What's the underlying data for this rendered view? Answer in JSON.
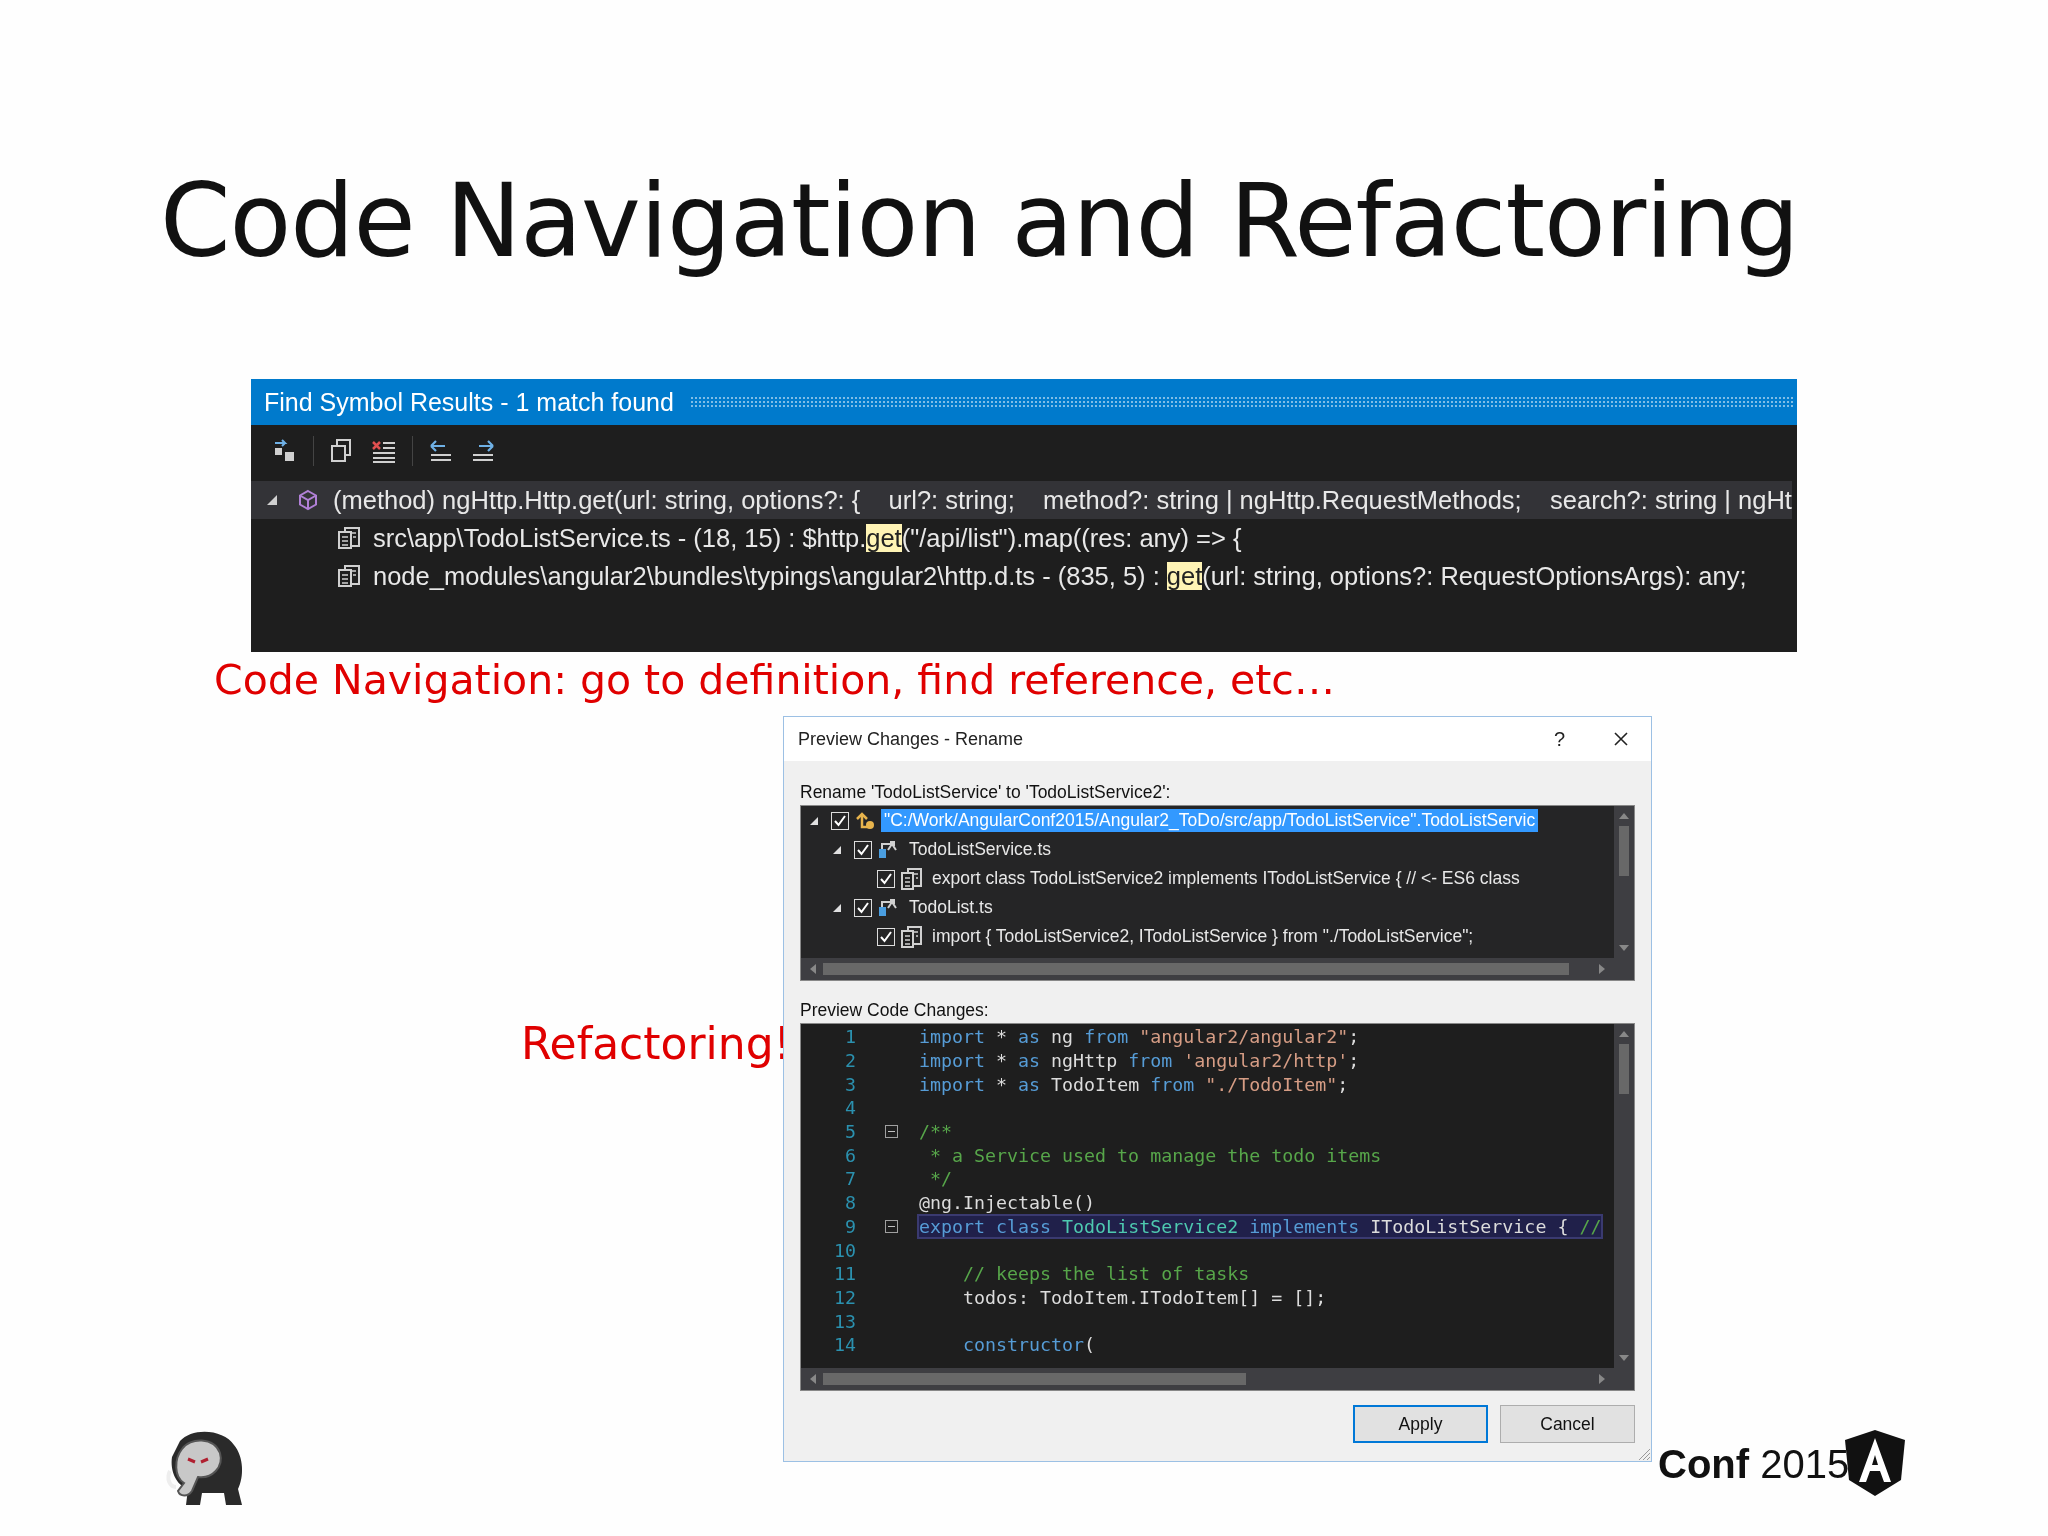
{
  "slide": {
    "title": "Code Navigation and Refactoring"
  },
  "find_results": {
    "title": "Find Symbol Results - 1 match found",
    "rows": [
      {
        "kind": "symbol",
        "expanded": true,
        "selected": true,
        "parts": [
          {
            "text": "(method) ngHttp.Http.get(url: string, options?: {    url?: string;    method?: string | ngHttp.RequestMethods;    search?: string | ngHt",
            "highlighted": false
          }
        ]
      },
      {
        "kind": "reference",
        "selected": false,
        "parts": [
          {
            "text": "src\\app\\TodoListService.ts - (18, 15) : $http.",
            "highlighted": false
          },
          {
            "text": "get",
            "highlighted": true
          },
          {
            "text": "(\"/api/list\").map((res: any) => {",
            "highlighted": false
          }
        ]
      },
      {
        "kind": "reference",
        "selected": false,
        "parts": [
          {
            "text": "node_modules\\angular2\\bundles\\typings\\angular2\\http.d.ts - (835, 5) : ",
            "highlighted": false
          },
          {
            "text": "get",
            "highlighted": true
          },
          {
            "text": "(url: string, options?: RequestOptionsArgs): any;",
            "highlighted": false
          }
        ]
      }
    ]
  },
  "caption_navigation": "Code Navigation: go to definition, find reference, etc…",
  "caption_refactoring": "Refactoring!",
  "dialog": {
    "title": "Preview Changes - Rename",
    "help": "?",
    "rename_label": "Rename 'TodoListService' to 'TodoListService2':",
    "tree": [
      {
        "kind": "project",
        "label": "\"C:/Work/AngularConf2015/Angular2_ToDo/src/app/TodoListService\".TodoListServic",
        "checked": true,
        "expanded": true,
        "selected": true,
        "children": [
          {
            "kind": "file",
            "label": "TodoListService.ts",
            "checked": true,
            "expanded": true,
            "selected": false,
            "children": [
              {
                "kind": "line",
                "label": "export class TodoListService2 implements ITodoListService { // <- ES6 class",
                "checked": true,
                "selected": false
              }
            ]
          },
          {
            "kind": "file",
            "label": "TodoList.ts",
            "checked": true,
            "expanded": true,
            "selected": false,
            "children": [
              {
                "kind": "line",
                "label": "import { TodoListService2, ITodoListService } from \"./TodoListService\";",
                "checked": true,
                "selected": false
              }
            ]
          }
        ]
      }
    ],
    "preview_label": "Preview Code Changes:",
    "code_lines": [
      {
        "number": "1",
        "selected": false,
        "collapsible": false,
        "tokens": [
          {
            "kind": "keyword",
            "text": "import"
          },
          {
            "kind": "plain",
            "text": " * "
          },
          {
            "kind": "keyword",
            "text": "as"
          },
          {
            "kind": "plain",
            "text": " ng "
          },
          {
            "kind": "keyword",
            "text": "from"
          },
          {
            "kind": "string",
            "text": " \"angular2/angular2\""
          },
          {
            "kind": "plain",
            "text": ";"
          }
        ]
      },
      {
        "number": "2",
        "selected": false,
        "collapsible": false,
        "tokens": [
          {
            "kind": "keyword",
            "text": "import"
          },
          {
            "kind": "plain",
            "text": " * "
          },
          {
            "kind": "keyword",
            "text": "as"
          },
          {
            "kind": "plain",
            "text": " ngHttp "
          },
          {
            "kind": "keyword",
            "text": "from"
          },
          {
            "kind": "string",
            "text": " 'angular2/http'"
          },
          {
            "kind": "plain",
            "text": ";"
          }
        ]
      },
      {
        "number": "3",
        "selected": false,
        "collapsible": false,
        "tokens": [
          {
            "kind": "keyword",
            "text": "import"
          },
          {
            "kind": "plain",
            "text": " * "
          },
          {
            "kind": "keyword",
            "text": "as"
          },
          {
            "kind": "plain",
            "text": " TodoItem "
          },
          {
            "kind": "keyword",
            "text": "from"
          },
          {
            "kind": "string",
            "text": " \"./TodoItem\""
          },
          {
            "kind": "plain",
            "text": ";"
          }
        ]
      },
      {
        "number": "4",
        "selected": false,
        "collapsible": false
      },
      {
        "number": "5",
        "selected": false,
        "collapsible": true,
        "tokens": [
          {
            "kind": "comment",
            "text": "/**"
          }
        ]
      },
      {
        "number": "6",
        "selected": false,
        "collapsible": false,
        "tokens": [
          {
            "kind": "comment",
            "text": " * a Service used to manage the todo items"
          }
        ]
      },
      {
        "number": "7",
        "selected": false,
        "collapsible": false,
        "tokens": [
          {
            "kind": "comment",
            "text": " */"
          }
        ]
      },
      {
        "number": "8",
        "selected": false,
        "collapsible": false,
        "tokens": [
          {
            "kind": "plain",
            "text": "@ng.Injectable()"
          }
        ]
      },
      {
        "number": "9",
        "selected": true,
        "collapsible": true,
        "tokens": [
          {
            "kind": "keyword",
            "text": "export"
          },
          {
            "kind": "keyword",
            "text": " class"
          },
          {
            "kind": "type",
            "text": " TodoListService2"
          },
          {
            "kind": "keyword",
            "text": " implements"
          },
          {
            "kind": "plain",
            "text": " ITodoListService { "
          },
          {
            "kind": "comment",
            "text": "//"
          }
        ]
      },
      {
        "number": "10",
        "selected": false,
        "collapsible": false
      },
      {
        "number": "11",
        "selected": false,
        "collapsible": false,
        "tokens": [
          {
            "kind": "comment",
            "text": "    // keeps the list of tasks"
          }
        ]
      },
      {
        "number": "12",
        "selected": false,
        "collapsible": false,
        "tokens": [
          {
            "kind": "plain",
            "text": "    todos: TodoItem.ITodoItem[] = [];"
          }
        ]
      },
      {
        "number": "13",
        "selected": false,
        "collapsible": false
      },
      {
        "number": "14",
        "selected": false,
        "collapsible": false,
        "tokens": [
          {
            "kind": "keyword",
            "text": "    constructor"
          },
          {
            "kind": "plain",
            "text": "("
          }
        ]
      }
    ],
    "buttons": [
      {
        "label": "Apply",
        "default": true
      },
      {
        "label": "Cancel",
        "default": false
      }
    ]
  },
  "footer": {
    "brand": "**Conf** 2015"
  }
}
